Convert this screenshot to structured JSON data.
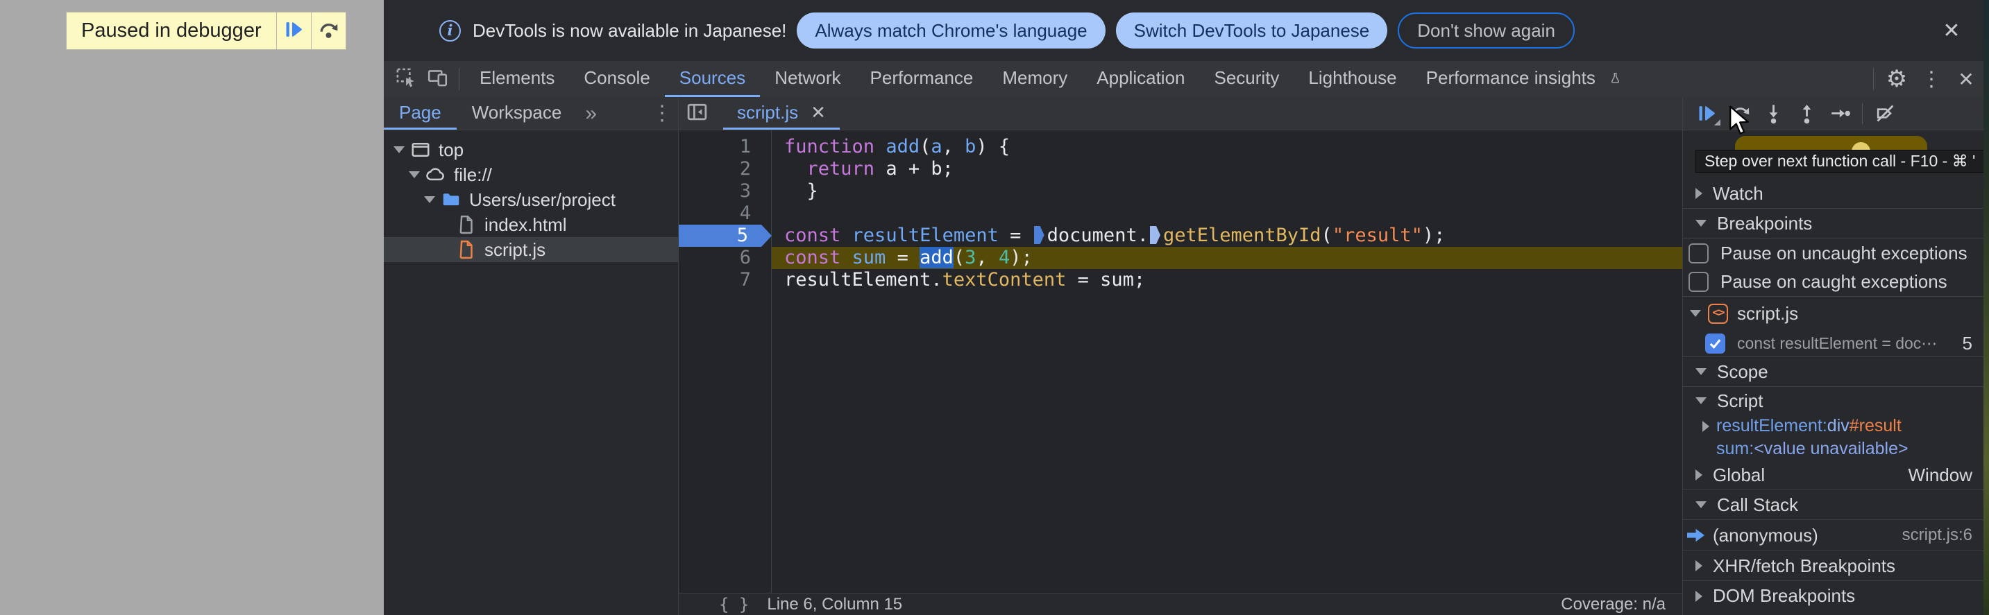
{
  "icons": {
    "info": "i",
    "close": "✕",
    "kebab": "⋮",
    "gear": "⚙",
    "overflow": "»",
    "braces": "{ }",
    "script_badge": "<>",
    "tab_close": "✕"
  },
  "colors": {
    "accent_blue": "#7cacf8",
    "chip_bg": "#a8c7fa",
    "paused_yellow": "#fdf9c2",
    "exec_line": "#554a08",
    "breakpoint_blue": "#4d80d8",
    "js_orange": "#ee8147"
  },
  "page": {
    "paused_banner": {
      "label": "Paused in debugger"
    }
  },
  "infobar": {
    "message": "DevTools is now available in Japanese!",
    "actions": [
      {
        "label": "Always match Chrome's language",
        "style": "filled"
      },
      {
        "label": "Switch DevTools to Japanese",
        "style": "filled"
      },
      {
        "label": "Don't show again",
        "style": "outline"
      }
    ]
  },
  "main_tabs": {
    "selected": "Sources",
    "items": [
      {
        "label": "Elements"
      },
      {
        "label": "Console"
      },
      {
        "label": "Sources"
      },
      {
        "label": "Network"
      },
      {
        "label": "Performance"
      },
      {
        "label": "Memory"
      },
      {
        "label": "Application"
      },
      {
        "label": "Security"
      },
      {
        "label": "Lighthouse"
      },
      {
        "label": "Performance insights",
        "icon": "flask"
      }
    ]
  },
  "navigator": {
    "tabs": [
      {
        "label": "Page",
        "selected": true
      },
      {
        "label": "Workspace",
        "selected": false
      }
    ],
    "tree": [
      {
        "label": "top",
        "icon": "frame",
        "depth": 0,
        "expander": "down"
      },
      {
        "label": "file://",
        "icon": "cloud",
        "depth": 1,
        "expander": "down"
      },
      {
        "label": "Users/user/project",
        "icon": "folder",
        "depth": 2,
        "expander": "down"
      },
      {
        "label": "index.html",
        "icon": "file-html",
        "depth": 3,
        "expander": "none"
      },
      {
        "label": "script.js",
        "icon": "file-js",
        "depth": 3,
        "expander": "none",
        "selected": true
      }
    ]
  },
  "editor": {
    "tab": {
      "label": "script.js"
    },
    "code": {
      "lines": [
        {
          "num": "1",
          "tokens": [
            [
              "kw",
              "function"
            ],
            [
              "pl",
              " "
            ],
            [
              "df",
              "add"
            ],
            [
              "pl",
              "("
            ],
            [
              "df",
              "a"
            ],
            [
              "pl",
              ", "
            ],
            [
              "df",
              "b"
            ],
            [
              "pl",
              ") {"
            ]
          ]
        },
        {
          "num": "2",
          "tokens": [
            [
              "pl",
              "  "
            ],
            [
              "kw",
              "return"
            ],
            [
              "pl",
              " a + b;"
            ]
          ]
        },
        {
          "num": "3",
          "tokens": [
            [
              "pl",
              "  }"
            ]
          ]
        },
        {
          "num": "4",
          "tokens": []
        },
        {
          "num": "5",
          "breakpoint": true,
          "tokens": [
            [
              "kw",
              "const"
            ],
            [
              "pl",
              " "
            ],
            [
              "df",
              "resultElement"
            ],
            [
              "pl",
              " = "
            ],
            [
              "mk1",
              ""
            ],
            [
              "pl",
              "document."
            ],
            [
              "mk2",
              ""
            ],
            [
              "pr",
              "getElementById"
            ],
            [
              "pl",
              "("
            ],
            [
              "st",
              "\"result\""
            ],
            [
              "pl",
              ");"
            ]
          ]
        },
        {
          "num": "6",
          "paused": true,
          "tokens": [
            [
              "kw",
              "const"
            ],
            [
              "pl",
              " "
            ],
            [
              "df",
              "sum"
            ],
            [
              "pl",
              " = "
            ],
            [
              "sel",
              "add"
            ],
            [
              "pl",
              "("
            ],
            [
              "nu",
              "3"
            ],
            [
              "pl",
              ", "
            ],
            [
              "nu",
              "4"
            ],
            [
              "pl",
              ");"
            ]
          ]
        },
        {
          "num": "7",
          "tokens": [
            [
              "pl",
              "resultElement."
            ],
            [
              "pr",
              "textContent"
            ],
            [
              "pl",
              " = sum;"
            ]
          ]
        }
      ]
    },
    "status": {
      "left": "Line 6, Column 15",
      "right": "Coverage: n/a"
    }
  },
  "debugger_panel": {
    "toolbar": [
      "resume",
      "step-over",
      "step-into",
      "step-out",
      "step",
      "separator",
      "deactivate-breakpoints"
    ],
    "tooltip": "Step over next function call - F10 - ⌘ '",
    "rows": [
      {
        "type": "header",
        "label": "Watch",
        "state": "collapsed",
        "border": true
      },
      {
        "type": "header",
        "label": "Breakpoints",
        "state": "expanded",
        "border": true
      },
      {
        "type": "checkbox",
        "label": "Pause on uncaught exceptions",
        "checked": false
      },
      {
        "type": "checkbox",
        "label": "Pause on caught exceptions",
        "checked": false,
        "border": true
      },
      {
        "type": "bp-group",
        "label": "script.js",
        "state": "expanded"
      },
      {
        "type": "bp-item",
        "label": "const resultElement = doc⋯",
        "line": "5",
        "checked": true,
        "border": true
      },
      {
        "type": "header",
        "label": "Scope",
        "state": "expanded",
        "border": true
      },
      {
        "type": "scope-sub",
        "label": "Script",
        "state": "expanded"
      },
      {
        "type": "scope-prop",
        "name": "resultElement",
        "expander": true,
        "value_parts": [
          [
            "sc-node",
            "div"
          ],
          [
            "sc-id",
            "#result"
          ]
        ]
      },
      {
        "type": "scope-prop",
        "name": "sum",
        "expander": false,
        "value_parts": [
          [
            "sc-unavail",
            "<value unavailable>"
          ]
        ]
      },
      {
        "type": "scope-node",
        "label": "Global",
        "state": "collapsed",
        "right": "Window",
        "border": true
      },
      {
        "type": "header",
        "label": "Call Stack",
        "state": "expanded",
        "border": true
      },
      {
        "type": "stack-frame",
        "label": "(anonymous)",
        "location": "script.js:6",
        "active": true,
        "border": true
      },
      {
        "type": "header",
        "label": "XHR/fetch Breakpoints",
        "state": "collapsed",
        "border": true
      },
      {
        "type": "header",
        "label": "DOM Breakpoints",
        "state": "collapsed",
        "border": false
      }
    ]
  }
}
